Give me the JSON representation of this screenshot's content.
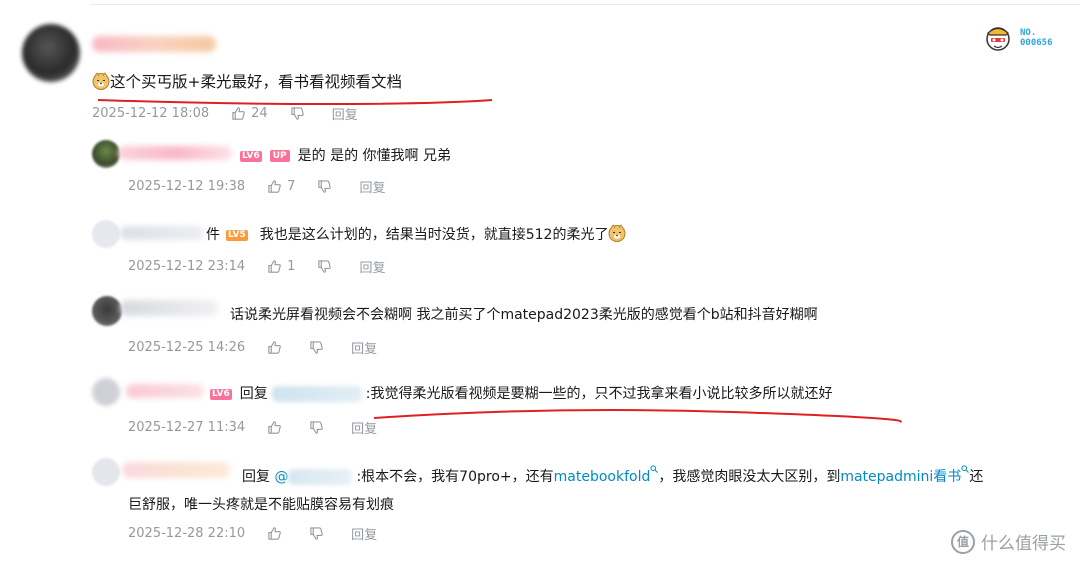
{
  "main_comment": {
    "text": "这个买丐版+柔光最好，看书看视频看文档",
    "timestamp": "2025-12-12 18:08",
    "like_count": "24",
    "reply_label": "回复"
  },
  "badge": {
    "line1": "NO.",
    "line2": "000656"
  },
  "replies": [
    {
      "level": "LV6",
      "up_tag": "UP",
      "text": "是的 是的  你懂我啊 兄弟",
      "timestamp": "2025-12-12 19:38",
      "like_count": "7",
      "reply_label": "回复"
    },
    {
      "name_tail": "件",
      "level": "LV5",
      "text": "我也是这么计划的，结果当时没货，就直接512的柔光了",
      "timestamp": "2025-12-12 23:14",
      "like_count": "1",
      "reply_label": "回复"
    },
    {
      "text": "话说柔光屏看视频会不会糊啊 我之前买了个matepad2023柔光版的感觉看个b站和抖音好糊啊",
      "timestamp": "2025-12-25 14:26",
      "like_count": "",
      "reply_label": "回复"
    },
    {
      "level": "LV6",
      "prefix": "回复",
      "text": ":我觉得柔光版看视频是要糊一些的，只不过我拿来看小说比较多所以就还好",
      "timestamp": "2025-12-27 11:34",
      "like_count": "",
      "reply_label": "回复"
    },
    {
      "prefix": "回复",
      "at": "@",
      "text_a": ":根本不会，我有70pro+，还有",
      "link_a": "matebookfold",
      "text_b": "，我感觉肉眼没太大区别，到",
      "link_b": "matepadmini看书",
      "text_c": "还",
      "text_line2": "巨舒服，唯一头疼就是不能贴膜容易有划痕",
      "timestamp": "2025-12-28 22:10",
      "like_count": "",
      "reply_label": "回复"
    }
  ],
  "watermark": {
    "icon_text": "值",
    "text": "什么值得买"
  },
  "colors": {
    "accent_pink": "#fb7299",
    "link_blue": "#008ac5",
    "meta_gray": "#9499a0",
    "annotation_red": "#e02020"
  },
  "icons": [
    "thumb-up-icon",
    "thumb-down-icon",
    "doge-emoji-icon",
    "search-link-icon",
    "fan-badge-icon"
  ]
}
